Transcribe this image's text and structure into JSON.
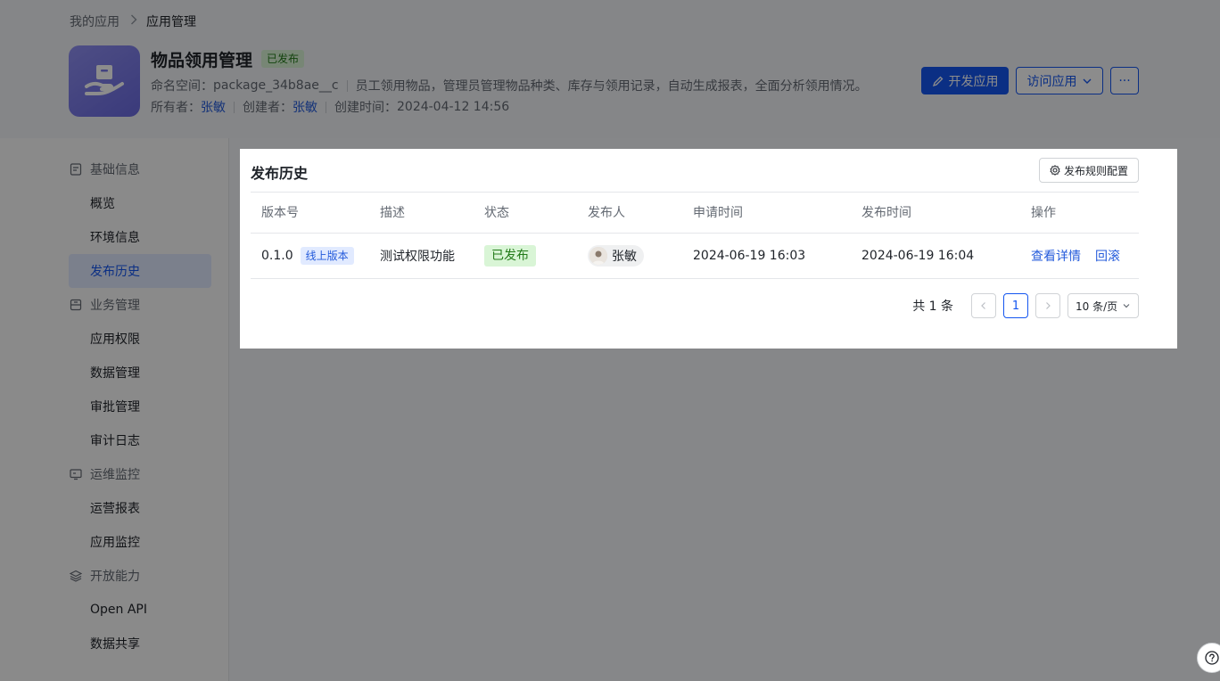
{
  "breadcrumb": {
    "parent": "我的应用",
    "current": "应用管理"
  },
  "app": {
    "name": "物品领用管理",
    "status_tag": "已发布",
    "namespace_label": "命名空间：",
    "namespace": "package_34b8ae__c",
    "description": "员工领用物品，管理员管理物品种类、库存与领用记录，自动生成报表，全面分析领用情况。",
    "owner_label": "所有者：",
    "owner": "张敏",
    "creator_label": "创建者：",
    "creator": "张敏",
    "created_label": "创建时间：",
    "created_time": "2024-04-12 14:56"
  },
  "actions": {
    "develop": "开发应用",
    "visit": "访问应用",
    "more": "···"
  },
  "sidebar": {
    "groups": [
      {
        "label": "基础信息",
        "items": [
          "概览",
          "环境信息",
          "发布历史"
        ]
      },
      {
        "label": "业务管理",
        "items": [
          "应用权限",
          "数据管理",
          "审批管理",
          "审计日志"
        ]
      },
      {
        "label": "运维监控",
        "items": [
          "运营报表",
          "应用监控"
        ]
      },
      {
        "label": "开放能力",
        "items": [
          "Open API",
          "数据共享"
        ]
      }
    ]
  },
  "main": {
    "title": "发布历史",
    "rule_button": "发布规则配置",
    "columns": [
      "版本号",
      "描述",
      "状态",
      "发布人",
      "申请时间",
      "发布时间",
      "操作"
    ],
    "rows": [
      {
        "version": "0.1.0",
        "version_tag": "线上版本",
        "desc": "测试权限功能",
        "status": "已发布",
        "publisher": "张敏",
        "apply_time": "2024-06-19 16:03",
        "publish_time": "2024-06-19 16:04",
        "op_detail": "查看详情",
        "op_rollback": "回滚"
      }
    ],
    "pagination": {
      "total": "共 1 条",
      "current": "1",
      "page_size": "10 条/页"
    }
  },
  "colors": {
    "primary": "#1456f0",
    "success_bg": "#d9f5d6",
    "success_text": "#237b19",
    "link": "#245bdb"
  }
}
